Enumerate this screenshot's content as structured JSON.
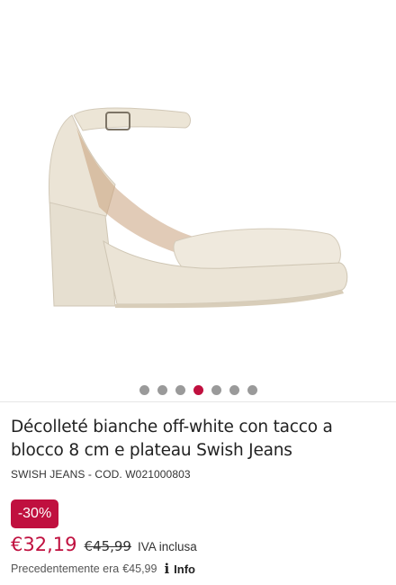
{
  "gallery": {
    "image_alt": "Décolleté bianche off-white con tacco a blocco",
    "slide_count": 7,
    "active_slide": 4
  },
  "product": {
    "title": "Décolleté bianche off-white con tacco a blocco 8 cm e plateau Swish Jeans",
    "brand": "SWISH JEANS",
    "code_separator": " - ",
    "code": "COD. W021000803"
  },
  "pricing": {
    "discount_badge": "-30%",
    "current_price": "€32,19",
    "old_price": "€45,99",
    "vat_label": "IVA inclusa",
    "previous_label": "Precedentemente era",
    "previous_amount": "€45,99",
    "info_label": "Info"
  },
  "colors": {
    "accent": "#c0103f",
    "dot_inactive": "#9a9a9a",
    "shoe": "#ece5d7"
  }
}
